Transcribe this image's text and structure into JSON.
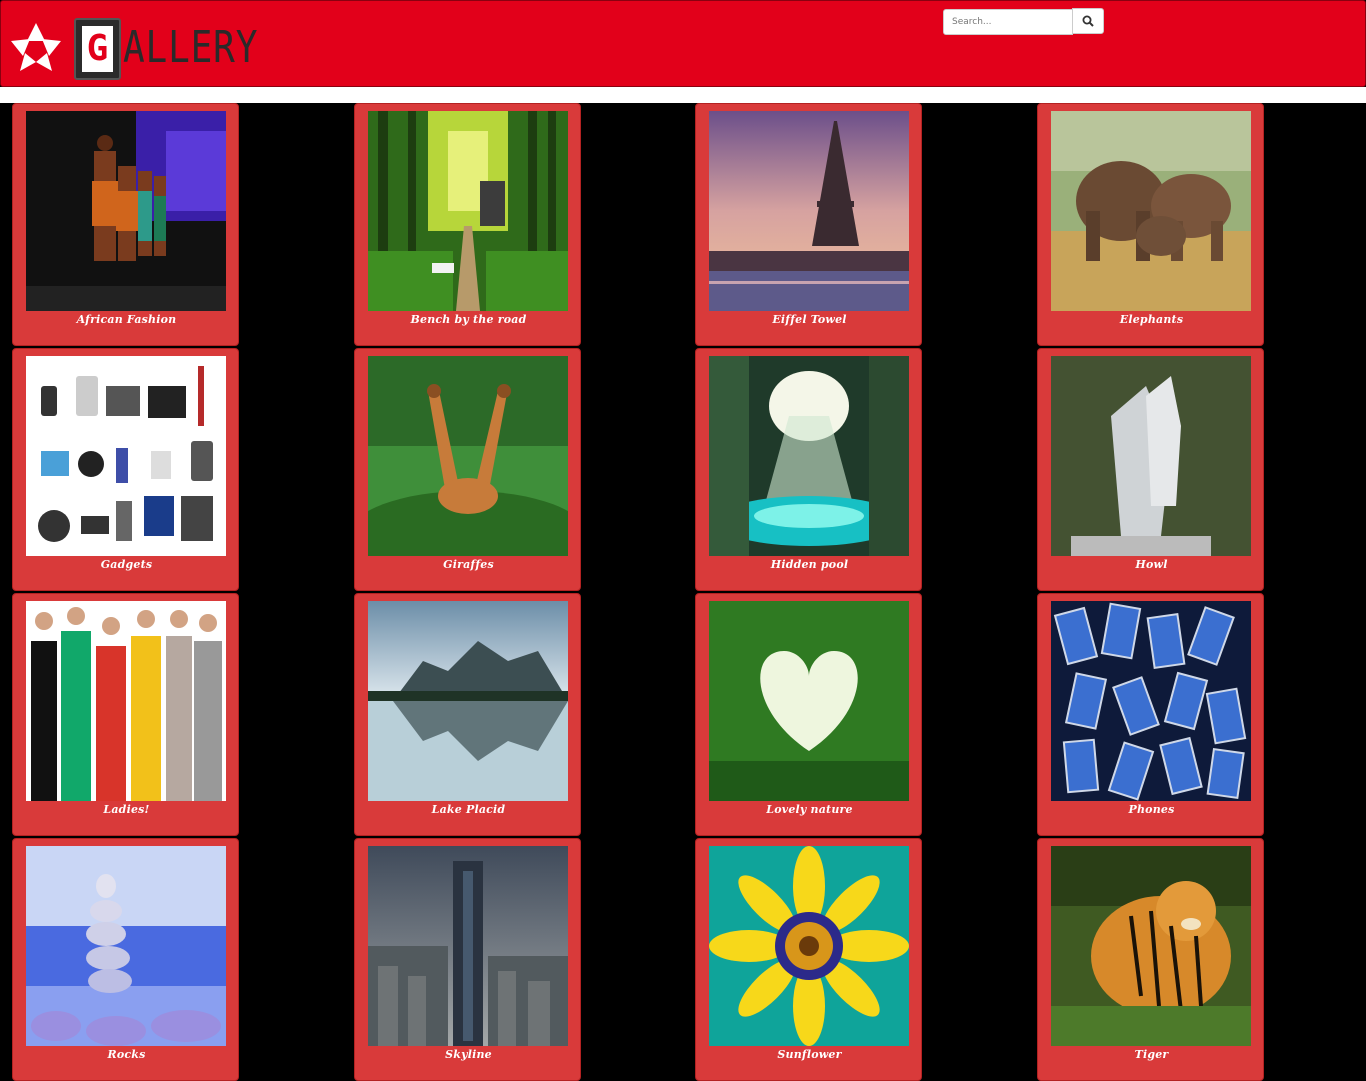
{
  "header": {
    "logo_letter": "G",
    "logo_text": "ALLERY",
    "search_placeholder": "Search..."
  },
  "colors": {
    "navbar": "#e2001a",
    "card": "#d93a3a",
    "background": "#000000"
  },
  "gallery": [
    {
      "caption": "African Fashion",
      "image": "fashion-runway"
    },
    {
      "caption": "Bench by the road",
      "image": "forest-bench"
    },
    {
      "caption": "Eiffel Towel",
      "image": "eiffel-tower"
    },
    {
      "caption": "Elephants",
      "image": "elephants"
    },
    {
      "caption": "Gadgets",
      "image": "gadgets"
    },
    {
      "caption": "Giraffes",
      "image": "giraffes"
    },
    {
      "caption": "Hidden pool",
      "image": "cave-pool"
    },
    {
      "caption": "Howl",
      "image": "wolves"
    },
    {
      "caption": "Ladies!",
      "image": "ladies"
    },
    {
      "caption": "Lake Placid",
      "image": "lake-mountains"
    },
    {
      "caption": "Lovely nature",
      "image": "heart-foliage"
    },
    {
      "caption": "Phones",
      "image": "phones-pile"
    },
    {
      "caption": "Rocks",
      "image": "stacked-rocks"
    },
    {
      "caption": "Skyline",
      "image": "city-skyline"
    },
    {
      "caption": "Sunflower",
      "image": "sunflower"
    },
    {
      "caption": "Tiger",
      "image": "tiger"
    }
  ]
}
